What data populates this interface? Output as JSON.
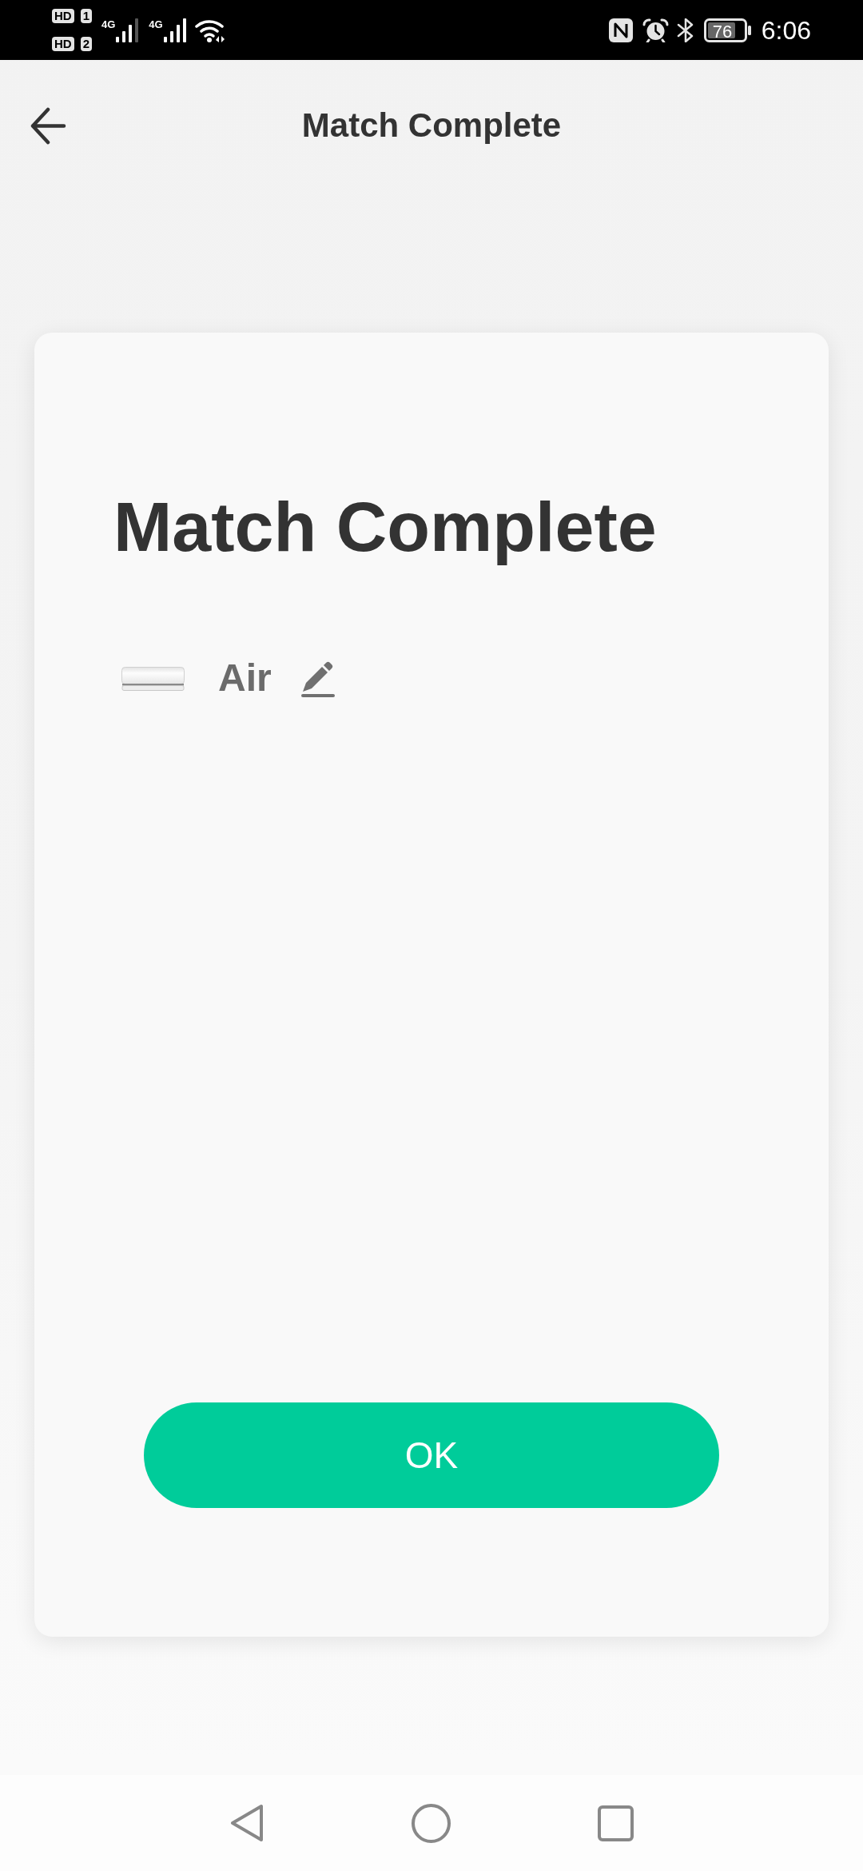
{
  "status_bar": {
    "sims": [
      {
        "hd": "HD",
        "slot": "1"
      },
      {
        "hd": "HD",
        "slot": "2"
      }
    ],
    "networks": [
      {
        "type": "4G"
      },
      {
        "type": "4G"
      }
    ],
    "battery": "76",
    "time": "6:06"
  },
  "header": {
    "title": "Match Complete"
  },
  "card": {
    "title": "Match Complete",
    "device": {
      "name": "Air"
    },
    "button": "OK"
  }
}
